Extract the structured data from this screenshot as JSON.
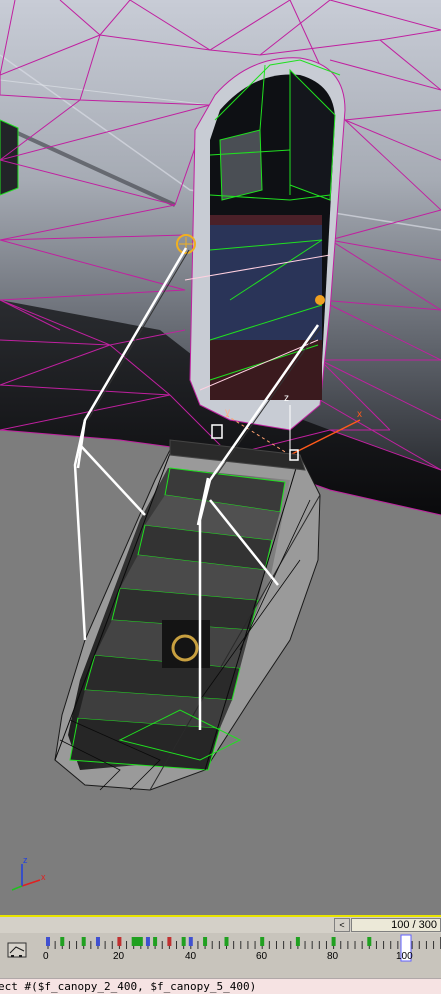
{
  "viewport": {
    "gizmo_labels": {
      "x": "x",
      "y": "y",
      "z": "z"
    },
    "axis_tripod_labels": {
      "x": "x",
      "z": "z"
    }
  },
  "time_slider": {
    "prev_arrow": "<",
    "frame_readout": "100 / 300"
  },
  "track_bar": {
    "tick_labels": [
      "0",
      "20",
      "40",
      "60",
      "80",
      "100"
    ]
  },
  "listener": {
    "text": "ect #($f_canopy_2_400, $f_canopy_5_400)"
  },
  "colors": {
    "viewport_bg": "#7d7d7d",
    "wireframe_magenta": "#c020a0",
    "wireframe_green": "#20e020",
    "gizmo_orange": "#ff5a1a",
    "time_slider_yellow": "#e8e400",
    "listener_pink": "#f6e3e3"
  }
}
